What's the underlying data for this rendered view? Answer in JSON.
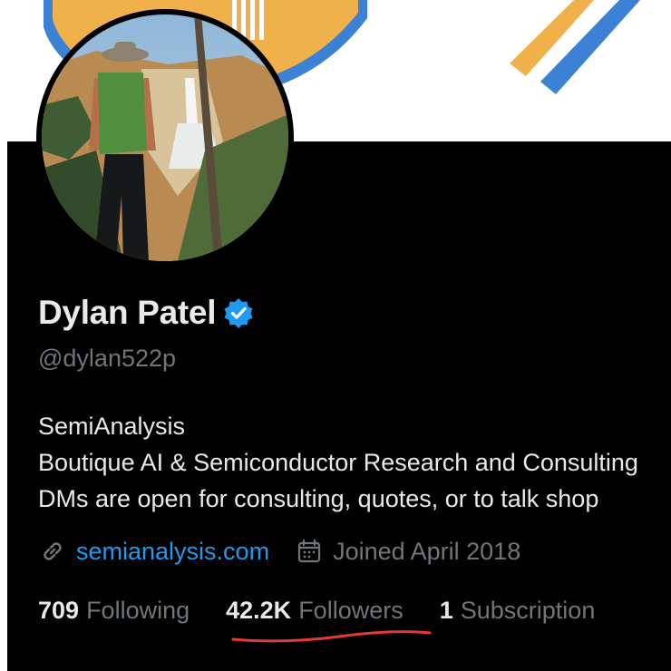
{
  "profile": {
    "name": "Dylan Patel",
    "handle": "@dylan522p",
    "verified": true,
    "bio_lines": [
      "SemiAnalysis",
      "Boutique AI & Semiconductor Research and Consulting",
      "DMs are open for consulting, quotes, or to talk shop"
    ],
    "website": "semianalysis.com",
    "joined": "Joined April 2018"
  },
  "stats": {
    "following": {
      "count": "709",
      "label": "Following"
    },
    "followers": {
      "count": "42.2K",
      "label": "Followers"
    },
    "subscriptions": {
      "count": "1",
      "label": "Subscription"
    }
  },
  "icons": {
    "verified": "verified-badge-icon",
    "website": "link-icon",
    "joined": "calendar-icon"
  },
  "colors": {
    "background": "#000000",
    "accent_blue": "#1d9bf0",
    "muted_text": "#71767b",
    "banner_orange": "#f0b04a",
    "banner_blue": "#3b82d6",
    "annotation_underline": "#e53935"
  }
}
